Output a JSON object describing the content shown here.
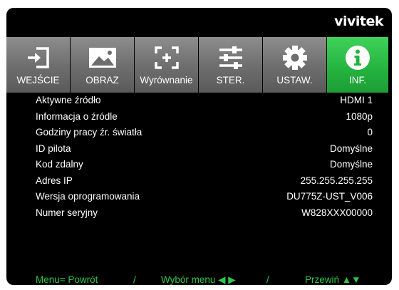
{
  "brand": "vivitek",
  "tabs": [
    {
      "label": "WEJŚCIE",
      "icon": "input-icon",
      "active": false
    },
    {
      "label": "OBRAZ",
      "icon": "image-icon",
      "active": false
    },
    {
      "label": "Wyrównanie",
      "icon": "alignment-icon",
      "active": false
    },
    {
      "label": "STER.",
      "icon": "sliders-icon",
      "active": false
    },
    {
      "label": "USTAW.",
      "icon": "gear-icon",
      "active": false
    },
    {
      "label": "INF.",
      "icon": "info-icon",
      "active": true
    }
  ],
  "rows": [
    {
      "label": "Aktywne źródło",
      "value": "HDMI 1"
    },
    {
      "label": "Informacja o źródle",
      "value": "1080p"
    },
    {
      "label": "Godziny pracy źr. światła",
      "value": "0"
    },
    {
      "label": "ID pilota",
      "value": "Domyślne"
    },
    {
      "label": "Kod zdalny",
      "value": "Domyślne"
    },
    {
      "label": "Adres IP",
      "value": "255.255.255.255"
    },
    {
      "label": "Wersja oprogramowania",
      "value": "DU775Z-UST_V006"
    },
    {
      "label": "Numer seryjny",
      "value": "W828XXX00000"
    }
  ],
  "footer": {
    "back": "Menu= Powrót",
    "sep1": "/",
    "select": "Wybór menu ◀ ▶",
    "sep2": "/",
    "scroll": "Przewiń ▲▼"
  },
  "colors": {
    "active_tab": "#24b23f",
    "inactive_tab": "#6d6d6d",
    "footer_text": "#2ec84a",
    "background": "#000000"
  }
}
